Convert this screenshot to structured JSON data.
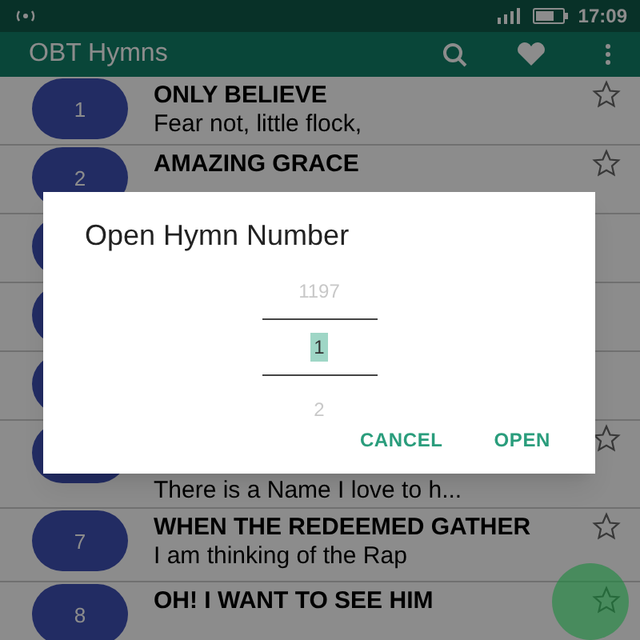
{
  "status_bar": {
    "time": "17:09"
  },
  "app_bar": {
    "title": "OBT Hymns"
  },
  "hymns": [
    {
      "kind": "entry",
      "number": "1",
      "title": "ONLY BELIEVE",
      "subtitle": "Fear not, little flock,"
    },
    {
      "kind": "entry",
      "number": "2",
      "title": "AMAZING GRACE"
    },
    {
      "kind": "covered"
    },
    {
      "kind": "covered"
    },
    {
      "kind": "covered"
    },
    {
      "kind": "entry",
      "subtitle": "There is a Name I love to h..."
    },
    {
      "kind": "entry",
      "number": "7",
      "title": "WHEN THE REDEEMED GATHER",
      "subtitle": "I am thinking of the Rap"
    },
    {
      "kind": "entry",
      "number": "8",
      "title": "OH! I WANT TO SEE HIM"
    }
  ],
  "dialog": {
    "title": "Open Hymn Number",
    "picker": {
      "previous": "1197",
      "value": "1",
      "next": "2"
    },
    "buttons": [
      "CANCEL",
      "OPEN"
    ]
  }
}
